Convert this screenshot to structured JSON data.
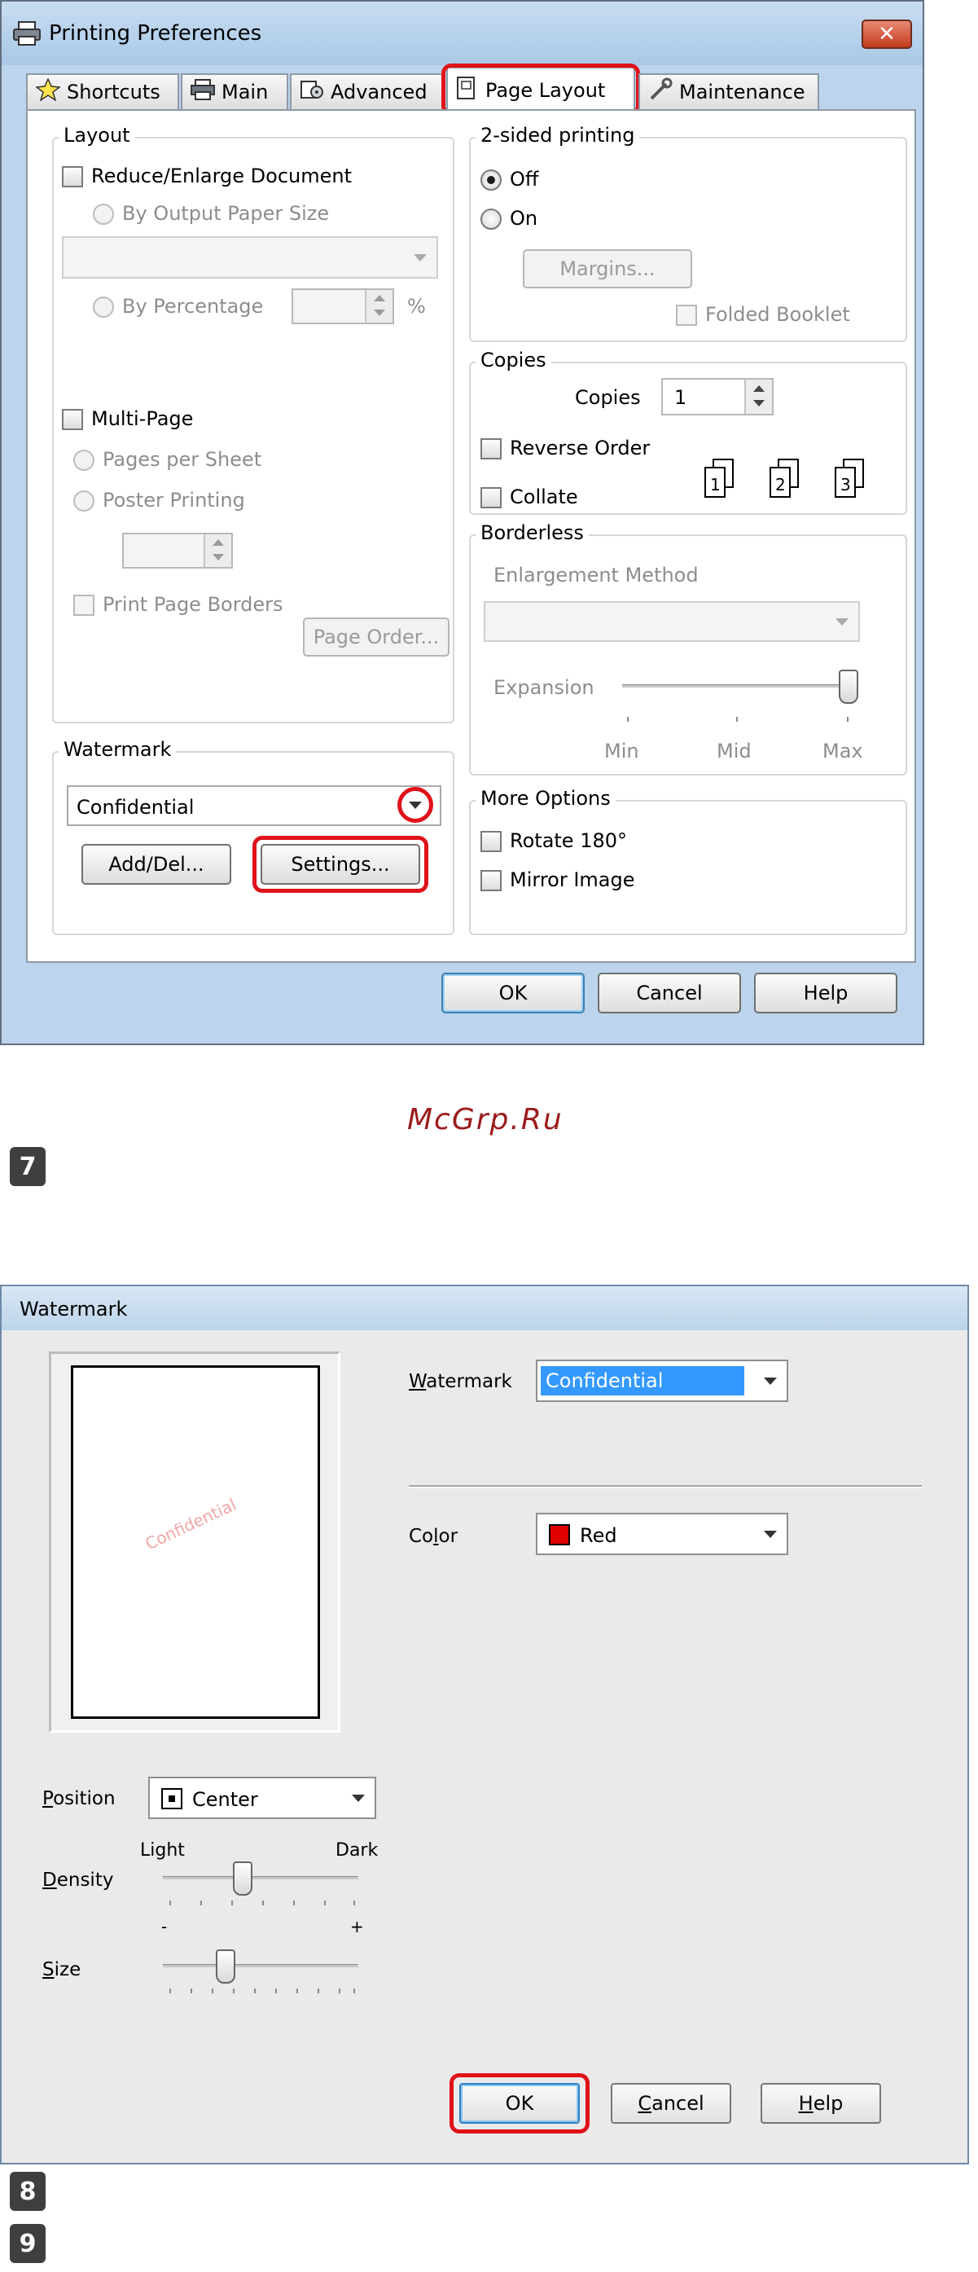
{
  "prefs": {
    "title": "Printing Preferences",
    "close_label": "✕",
    "tabs": [
      {
        "label": "Shortcuts"
      },
      {
        "label": "Main"
      },
      {
        "label": "Advanced"
      },
      {
        "label": "Page Layout"
      },
      {
        "label": "Maintenance"
      }
    ],
    "layout": {
      "group_label": "Layout",
      "reduce_enlarge": "Reduce/Enlarge Document",
      "by_output_paper_size": "By Output Paper Size",
      "output_paper_value": "",
      "by_percentage": "By Percentage",
      "percentage_value": "",
      "percent_sign": "%",
      "multi_page": "Multi-Page",
      "pages_per_sheet": "Pages per Sheet",
      "poster_printing": "Poster Printing",
      "poster_value": "",
      "print_page_borders": "Print Page Borders",
      "page_order": "Page Order..."
    },
    "watermark": {
      "group_label": "Watermark",
      "selected": "Confidential",
      "add_del": "Add/Del...",
      "settings": "Settings..."
    },
    "two_sided": {
      "group_label": "2-sided printing",
      "off": "Off",
      "on": "On",
      "margins": "Margins...",
      "folded_booklet": "Folded Booklet"
    },
    "copies": {
      "group_label": "Copies",
      "copies_label": "Copies",
      "copies_value": "1",
      "reverse_order": "Reverse Order",
      "collate": "Collate",
      "collate_icons": [
        "1",
        "2",
        "3"
      ]
    },
    "borderless": {
      "group_label": "Borderless",
      "enlargement_method": "Enlargement Method",
      "enlargement_value": "",
      "expansion": "Expansion",
      "min": "Min",
      "mid": "Mid",
      "max": "Max"
    },
    "more_options": {
      "group_label": "More Options",
      "rotate_180": "Rotate 180°",
      "mirror_image": "Mirror Image"
    },
    "buttons": {
      "ok": "OK",
      "cancel": "Cancel",
      "help": "Help"
    }
  },
  "watermark_text": "McGrp.Ru",
  "steps": [
    "7",
    "8",
    "9"
  ],
  "wm_dialog": {
    "title": "Watermark",
    "watermark_label_ul": "W",
    "watermark_label_rest": "atermark",
    "watermark_value": "Confidential",
    "preview_text": "Confidential",
    "color_label_pre": "Co",
    "color_label_ul": "l",
    "color_label_rest": "or",
    "color_value": "Red",
    "color_swatch": "#e00000",
    "position_label_ul": "P",
    "position_label_rest": "osition",
    "position_value": "Center",
    "density_label_ul": "D",
    "density_label_rest": "ensity",
    "density_light": "Light",
    "density_dark": "Dark",
    "density_level": 0.4,
    "size_label_ul": "S",
    "size_label_rest": "ize",
    "size_minus": "-",
    "size_plus": "+",
    "size_level": 0.3,
    "ok": "OK",
    "cancel_ul": "C",
    "cancel_rest": "ancel",
    "help_ul": "H",
    "help_rest": "elp"
  },
  "colors": {
    "highlight": "#e0121a",
    "selection": "#3399ff"
  }
}
